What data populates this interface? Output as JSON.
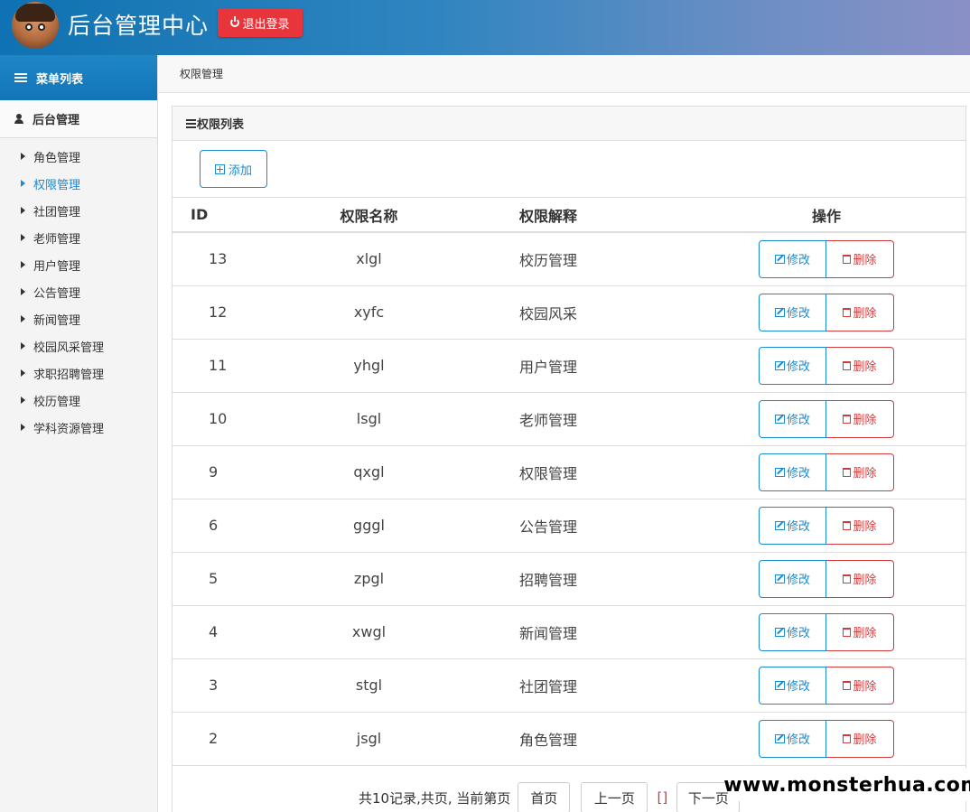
{
  "header": {
    "app_title": "后台管理中心",
    "logout_label": "退出登录"
  },
  "sidebar": {
    "menu_title": "菜单列表",
    "group_title": "后台管理",
    "items": [
      {
        "label": "角色管理",
        "active": false
      },
      {
        "label": "权限管理",
        "active": true
      },
      {
        "label": "社团管理",
        "active": false
      },
      {
        "label": "老师管理",
        "active": false
      },
      {
        "label": "用户管理",
        "active": false
      },
      {
        "label": "公告管理",
        "active": false
      },
      {
        "label": "新闻管理",
        "active": false
      },
      {
        "label": "校园风采管理",
        "active": false
      },
      {
        "label": "求职招聘管理",
        "active": false
      },
      {
        "label": "校历管理",
        "active": false
      },
      {
        "label": "学科资源管理",
        "active": false
      }
    ]
  },
  "breadcrumb": "权限管理",
  "panel": {
    "title": "权限列表",
    "add_label": "添加"
  },
  "table": {
    "columns": [
      "ID",
      "权限名称",
      "权限解释",
      "操作"
    ],
    "edit_label": "修改",
    "delete_label": "删除",
    "rows": [
      {
        "id": "13",
        "name": "xlgl",
        "desc": "校历管理"
      },
      {
        "id": "12",
        "name": "xyfc",
        "desc": "校园风采"
      },
      {
        "id": "11",
        "name": "yhgl",
        "desc": "用户管理"
      },
      {
        "id": "10",
        "name": "lsgl",
        "desc": "老师管理"
      },
      {
        "id": "9",
        "name": "qxgl",
        "desc": "权限管理"
      },
      {
        "id": "6",
        "name": "gggl",
        "desc": "公告管理"
      },
      {
        "id": "5",
        "name": "zpgl",
        "desc": "招聘管理"
      },
      {
        "id": "4",
        "name": "xwgl",
        "desc": "新闻管理"
      },
      {
        "id": "3",
        "name": "stgl",
        "desc": "社团管理"
      },
      {
        "id": "2",
        "name": "jsgl",
        "desc": "角色管理"
      }
    ]
  },
  "pagination": {
    "info": "共10记录,共页, 当前第页",
    "first": "首页",
    "prev": "上一页",
    "bracket": "[]",
    "next": "下一页"
  },
  "watermark": "www.monsterhua.com",
  "colors": {
    "accent": "#1c8ad0",
    "danger": "#d23b3b",
    "logout": "#e8343b"
  }
}
